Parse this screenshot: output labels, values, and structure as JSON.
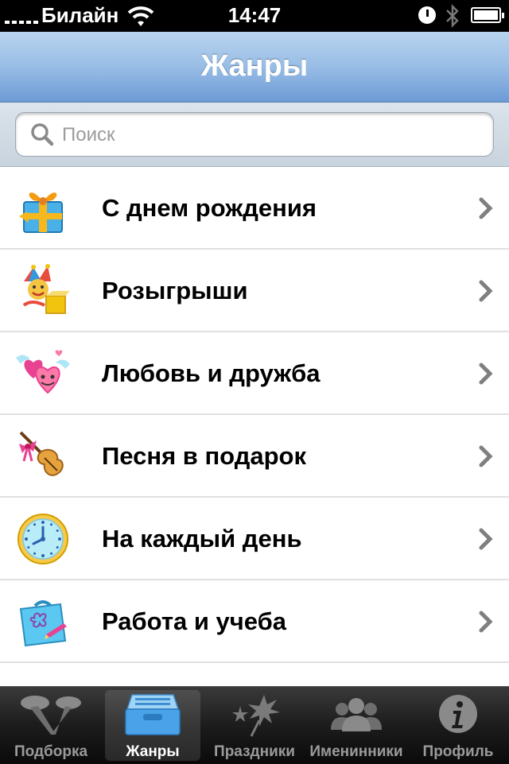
{
  "status": {
    "carrier": "Билайн",
    "time": "14:47"
  },
  "nav": {
    "title": "Жанры"
  },
  "search": {
    "placeholder": "Поиск"
  },
  "genres": [
    {
      "label": "С днем рождения",
      "icon": "gift-icon"
    },
    {
      "label": "Розыгрыши",
      "icon": "jester-icon"
    },
    {
      "label": "Любовь и дружба",
      "icon": "hearts-icon"
    },
    {
      "label": "Песня в подарок",
      "icon": "violin-icon"
    },
    {
      "label": "На каждый день",
      "icon": "clock-icon"
    },
    {
      "label": "Работа и учеба",
      "icon": "briefcase-icon"
    },
    {
      "label": "",
      "icon": "partial-icon"
    }
  ],
  "tabs": [
    {
      "label": "Подборка",
      "icon": "spotlight-icon",
      "active": false
    },
    {
      "label": "Жанры",
      "icon": "inbox-icon",
      "active": true
    },
    {
      "label": "Праздники",
      "icon": "fireworks-icon",
      "active": false
    },
    {
      "label": "Именинники",
      "icon": "people-icon",
      "active": false
    },
    {
      "label": "Профиль",
      "icon": "info-icon",
      "active": false
    }
  ],
  "colors": {
    "nav_bar": "#98bde6",
    "tab_bar": "#1c1c1c",
    "active_tab_label": "#ffffff"
  }
}
